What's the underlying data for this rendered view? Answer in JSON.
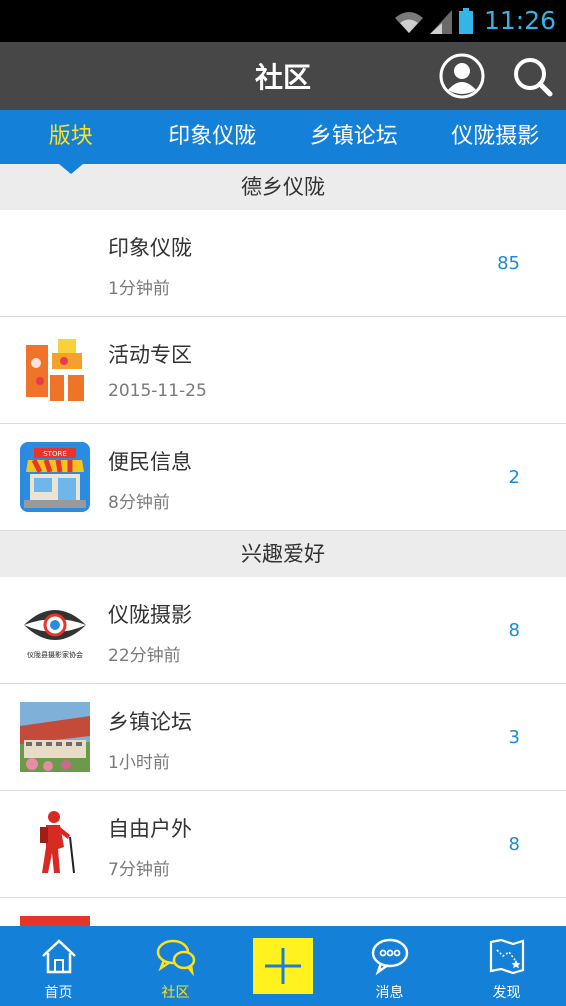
{
  "status_bar": {
    "time": "11:26"
  },
  "header": {
    "title": "社区"
  },
  "tabs": [
    {
      "label": "版块"
    },
    {
      "label": "印象仪陇"
    },
    {
      "label": "乡镇论坛"
    },
    {
      "label": "仪陇摄影"
    }
  ],
  "sections": [
    {
      "title": "德乡仪陇",
      "items": [
        {
          "name": "印象仪陇",
          "time": "1分钟前",
          "count": "85"
        },
        {
          "name": "活动专区",
          "time": "2015-11-25",
          "count": ""
        },
        {
          "name": "便民信息",
          "time": "8分钟前",
          "count": "2"
        }
      ]
    },
    {
      "title": "兴趣爱好",
      "items": [
        {
          "name": "仪陇摄影",
          "time": "22分钟前",
          "count": "8"
        },
        {
          "name": "乡镇论坛",
          "time": "1小时前",
          "count": "3"
        },
        {
          "name": "自由户外",
          "time": "7分钟前",
          "count": "8"
        }
      ]
    }
  ],
  "thumb_labels": {
    "store": "STORE",
    "photo_assoc": "仪陇县摄影家协会"
  },
  "bottom_nav": [
    {
      "label": "首页"
    },
    {
      "label": "社区"
    },
    {
      "label": "消息"
    },
    {
      "label": "发现"
    }
  ],
  "colors": {
    "accent": "#1580d8",
    "active": "#ffe11a",
    "titlebar": "#474747",
    "count": "#1a8ad8"
  }
}
